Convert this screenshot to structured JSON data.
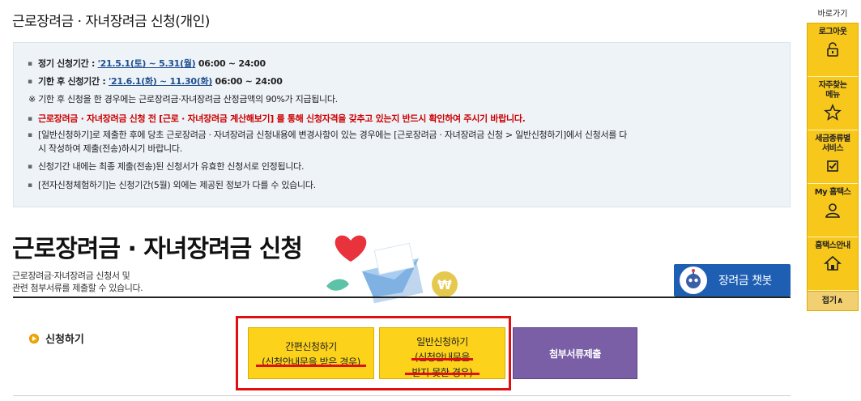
{
  "page_title": "근로장려금 · 자녀장려금 신청(개인)",
  "notice": {
    "regular_label": "정기 신청기간 : ",
    "regular_dates": "'21.5.1(토) ~ 5.31(월)",
    "regular_time": " 06:00 ~ 24:00",
    "late_label": "기한 후 신청기간 : ",
    "late_dates": "'21.6.1(화) ~ 11.30(화)",
    "late_time": " 06:00 ~ 24:00",
    "late_note": "※ 기한 후 신청을 한 경우에는 근로장려금·자녀장려금 산정금액의 90%가 지급됩니다.",
    "warning": "근로장려금 · 자녀장려금 신청 전 [근로 · 자녀장려금 계산해보기] 를 통해 신청자격을 갖추고 있는지 반드시 확인하여 주시기 바랍니다.",
    "change_1": "[일반신청하기]로 제출한 후에 당초 근로장려금 · 자녀장려금 신청내용에 변경사항이 있는 경우에는  [근로장려금 · 자녀장려금 신청 > 일반신청하기]에서  신청서를 다",
    "change_2": "시 작성하여 제출(전송)하시기 바랍니다.",
    "valid": "신청기간 내에는 최종 제출(전송)된 신청서가 유효한 신청서로 인정됩니다.",
    "trial": "[전자신청체험하기]는 신청기간(5월) 외에는 제공된 정보가 다를 수 있습니다."
  },
  "main": {
    "title": "근로장려금 · 자녀장려금 신청",
    "desc_1": "근로장려금·자녀장려금 신청서 및",
    "desc_2": "관련 첨부서류를 제출할 수 있습니다.",
    "chatbot_label": "장려금 챗봇",
    "apply_label": "신청하기",
    "buttons": {
      "simple_line1": "간편신청하기",
      "simple_line2": "(신청안내문을 받은 경우)",
      "general_line1": "일반신청하기",
      "general_line2": "(신청안내문을",
      "general_line3": "받지 못한 경우)",
      "attach": "첨부서류제출"
    }
  },
  "sidebar": {
    "header": "바로가기",
    "items": [
      {
        "label": "로그아웃",
        "icon": "lock-icon"
      },
      {
        "label_1": "자주찾는",
        "label_2": "메뉴",
        "icon": "star-icon"
      },
      {
        "label_1": "세금종류별",
        "label_2": "서비스",
        "icon": "checkbox-icon"
      },
      {
        "label": "My 홈택스",
        "icon": "person-icon"
      },
      {
        "label": "홈택스안내",
        "icon": "house-icon"
      }
    ],
    "fold": "접기∧"
  },
  "colors": {
    "accent_yellow": "#fcd21a",
    "purple": "#7a5fa6",
    "chatbot_blue": "#1e5fb4",
    "highlight_red": "#e01010"
  }
}
